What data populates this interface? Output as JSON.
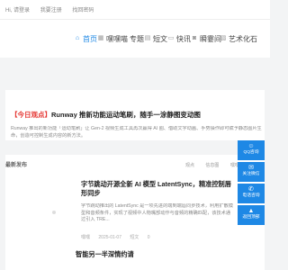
{
  "topbar": {
    "links": [
      "Hi, 请登录",
      "我要注册",
      "找回密码"
    ]
  },
  "nav": {
    "items": [
      {
        "label": "首页",
        "icon": "home-icon",
        "glyph": "⌂",
        "active": true
      },
      {
        "label": "嘿嘿喵",
        "icon": "grid-icon",
        "glyph": "▦",
        "active": false
      },
      {
        "label": "专题",
        "icon": "crosshair-icon",
        "glyph": "⊕",
        "active": false
      },
      {
        "label": "短文",
        "icon": "document-icon",
        "glyph": "▤",
        "active": false
      },
      {
        "label": "快讯",
        "icon": "chat-icon",
        "glyph": "▭",
        "active": false
      },
      {
        "label": "瞬霎间",
        "icon": "camera-icon",
        "glyph": "◙",
        "active": false
      },
      {
        "label": "艺术化石",
        "icon": "image-icon",
        "glyph": "▧",
        "active": false
      }
    ]
  },
  "hero": {
    "tag": "【今日观点】",
    "title": "Runway 推新功能运动笔刷，随手一涂静图变动图",
    "desc": "Runway 推出的新功能「运动笔刷」让 Gen-2 视频生成工具再次赢得 AI 圈、借助文字动画、手势操作即可赋予静态图片生命，创造可控制生成内容的新方法。"
  },
  "latest": {
    "label": "最新发布",
    "tabs": [
      "观点",
      "信息图",
      "嘿嘿喵"
    ]
  },
  "article": {
    "title": "字节跳动开源全新 AI 模型 LatentSync，精准控制唇形同步",
    "desc": "字节跳动推出的 LatentSync 是一项先进的端到端唇同步技术，利用扩散模型和音频条件，实现了视频中人物嘴部动作与音频的精确匹配，该技术通过引入 TRE...",
    "author": "嘿嘿",
    "date": "2025-01-07",
    "category": "短文",
    "views": "0"
  },
  "article2": {
    "title": "智能另一半深情约请"
  },
  "sidebar": {
    "items": [
      {
        "label": "QQ咨询",
        "icon": "qq-icon",
        "glyph": "☺"
      },
      {
        "label": "关注微信",
        "icon": "wechat-icon",
        "glyph": "✉"
      },
      {
        "label": "电话咨询",
        "icon": "phone-icon",
        "glyph": "✆"
      },
      {
        "label": "返回顶部",
        "icon": "arrow-up-icon",
        "glyph": "▲"
      }
    ]
  }
}
